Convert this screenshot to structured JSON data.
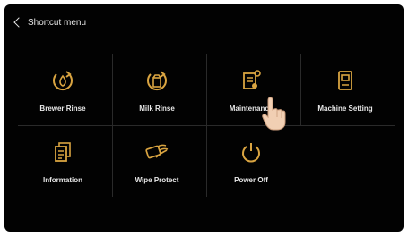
{
  "header": {
    "title": "Shortcut menu",
    "back_icon": "chevron-left-icon"
  },
  "accent_color": "#d9a441",
  "tiles": [
    {
      "label": "Brewer Rinse",
      "icon": "brewer-rinse-icon"
    },
    {
      "label": "Milk Rinse",
      "icon": "milk-rinse-icon"
    },
    {
      "label": "Maintenance",
      "icon": "maintenance-icon"
    },
    {
      "label": "Machine Setting",
      "icon": "machine-setting-icon"
    },
    {
      "label": "Information",
      "icon": "information-icon"
    },
    {
      "label": "Wipe Protect",
      "icon": "wipe-protect-icon"
    },
    {
      "label": "Power Off",
      "icon": "power-off-icon"
    }
  ]
}
